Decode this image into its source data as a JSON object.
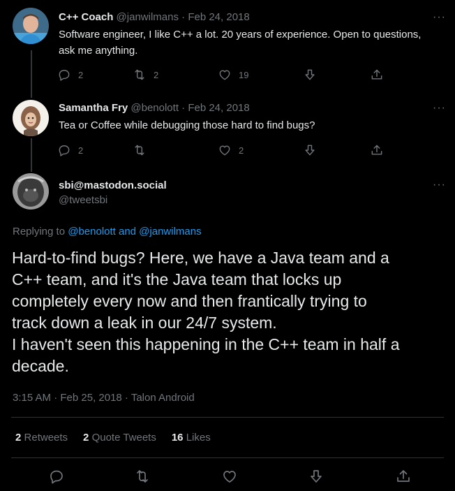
{
  "tweets": [
    {
      "name": "C++ Coach",
      "handle": "@janwilmans",
      "date": "Feb 24, 2018",
      "text": "Software engineer, I like C++ a lot. 20 years of experience.  Open to questions, ask me anything.",
      "replies": "2",
      "retweets": "2",
      "likes": "19"
    },
    {
      "name": "Samantha Fry",
      "handle": "@benolott",
      "date": "Feb 24, 2018",
      "text": "Tea or Coffee while debugging those hard to find bugs?",
      "replies": "2",
      "retweets": "",
      "likes": "2"
    }
  ],
  "main": {
    "name": "sbi@mastodon.social",
    "handle": "@tweetsbi",
    "replying_prefix": "Replying to",
    "replying_to": "@benolott and @janwilmans",
    "text_lines": [
      "Hard-to-find bugs? Here, we have a Java team and a",
      "C++ team, and it's the Java team that locks up",
      "completely every now and then frantically trying to",
      "track down a leak in our 24/7 system.",
      "I haven't seen this happening in the C++ team in half a",
      "decade."
    ],
    "timestamp": "3:15 AM · Feb 25, 2018 · Talon Android",
    "stats": {
      "retweets_count": "2",
      "retweets_label": "Retweets",
      "quotes_count": "2",
      "quotes_label": "Quote Tweets",
      "likes_count": "16",
      "likes_label": "Likes"
    }
  },
  "separator": "·",
  "more_label": "···",
  "icons": [
    "reply-icon",
    "retweet-icon",
    "like-icon",
    "downvote-icon",
    "share-icon",
    "more-icon"
  ],
  "colors": {
    "background": "#000000",
    "text": "#e7e9ea",
    "muted": "#71767b",
    "link": "#1d9bf0",
    "divider": "#2f3336"
  }
}
